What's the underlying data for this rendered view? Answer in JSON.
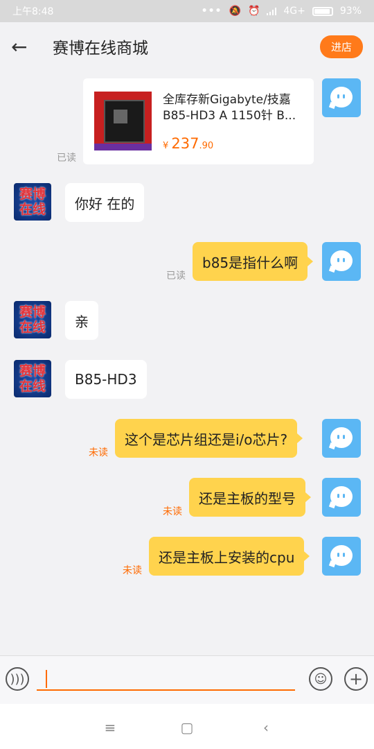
{
  "status": {
    "time": "上午8:48",
    "network": "4G+",
    "battery": "93%",
    "battery_level": 0.93
  },
  "header": {
    "title": "赛博在线商城",
    "shop_button": "进店",
    "back_icon": "arrow-left-icon"
  },
  "shop_avatar": {
    "line1": "赛博",
    "line2": "在线"
  },
  "product": {
    "title": "全库存新Gigabyte/技嘉 B85-HD3 A 1150针 B...",
    "currency": "¥",
    "price_int": "237",
    "price_dec": ".90",
    "read": "已读"
  },
  "messages": [
    {
      "side": "in",
      "text": "你好 在的"
    },
    {
      "side": "out",
      "text": "b85是指什么啊",
      "status": "已读"
    },
    {
      "side": "in",
      "text": "亲"
    },
    {
      "side": "in",
      "text": "B85-HD3"
    },
    {
      "side": "out",
      "text": "这个是芯片组还是i/o芯片?",
      "status": "未读"
    },
    {
      "side": "out",
      "text": "还是主板的型号",
      "status": "未读"
    },
    {
      "side": "out",
      "text": "还是主板上安装的cpu",
      "status": "未读"
    }
  ],
  "inputbar": {
    "voice_icon": "voice-icon",
    "emoji_icon": "emoji-icon",
    "plus_icon": "plus-icon"
  },
  "navbar": {
    "menu_icon": "menu-icon",
    "home_icon": "home-square-icon",
    "back_icon": "back-chevron-icon"
  },
  "colors": {
    "accent": "#ff7a1a",
    "bubble_out": "#ffd34d",
    "avatar_bot": "#5bb7f4",
    "unread": "#ff6a00"
  }
}
